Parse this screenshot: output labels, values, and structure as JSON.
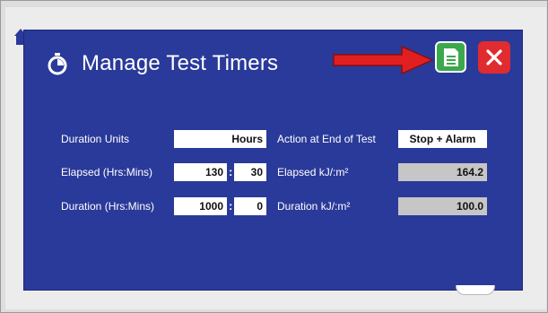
{
  "dialog": {
    "title": "Manage Test Timers",
    "colors": {
      "background": "#2a3a9a",
      "save": "#3ca84c",
      "close": "#e02b2f",
      "arrow": "#e02020"
    }
  },
  "toolbar": {
    "save_icon": "save-icon",
    "close_icon": "close-icon"
  },
  "form": {
    "duration_units": {
      "label": "Duration Units",
      "value": "Hours"
    },
    "action_end": {
      "label": "Action at End of Test",
      "value": "Stop + Alarm"
    },
    "elapsed_time": {
      "label": "Elapsed (Hrs:Mins)",
      "hours": "130",
      "minutes": "30"
    },
    "elapsed_energy": {
      "label": "Elapsed kJ/:m²",
      "value": "164.2"
    },
    "duration_time": {
      "label": "Duration (Hrs:Mins)",
      "hours": "1000",
      "minutes": "0"
    },
    "duration_energy": {
      "label": "Duration kJ/:m²",
      "value": "100.0"
    }
  }
}
